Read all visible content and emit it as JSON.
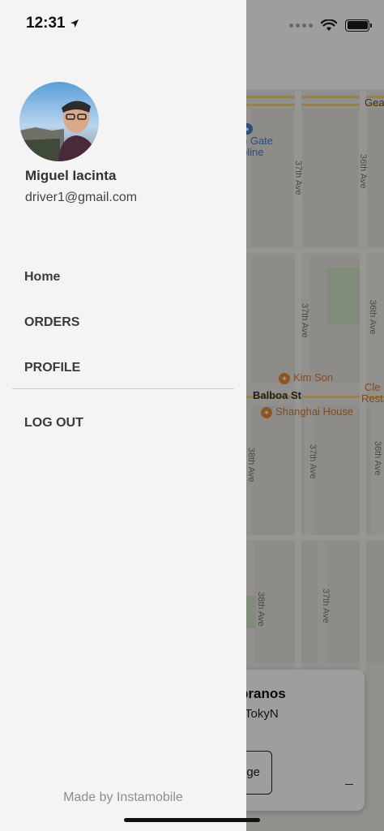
{
  "status_bar": {
    "time": "12:31"
  },
  "drawer": {
    "user": {
      "name": "Miguel Iacinta",
      "email": "driver1@gmail.com"
    },
    "menu": {
      "home": "Home",
      "orders": "ORDERS",
      "profile": "PROFILE",
      "logout": "LOG OUT"
    },
    "footer": "Made by Instamobile"
  },
  "map": {
    "labels": {
      "road_top": "Gea",
      "poi_blue_1": "n Gate",
      "poi_blue_2": "pline",
      "ave_37_a": "37th Ave",
      "ave_36_a": "36th Ave",
      "ave_37_b": "37th Ave",
      "ave_36_b": "36th Ave",
      "kim_son": "Kim Son",
      "cle_1": "Cle",
      "cle_2": "Resta",
      "balboa": "Balboa St",
      "shanghai": "Shanghai House",
      "ave_38_a": "38th Ave",
      "ave_37_c": "37th Ave",
      "ave_36_c": "36th Ave",
      "ave_38_b": "38th Ave",
      "ave_37_d": "37th Ave"
    },
    "card": {
      "title": "pranos",
      "subtitle": "TokyN",
      "button": "ge"
    }
  },
  "colors": {
    "drawer_bg": "#f4f4f4",
    "menu_text": "#3a3a3a",
    "footer_text": "#8e8e8e",
    "poi": "#d27a2e"
  }
}
